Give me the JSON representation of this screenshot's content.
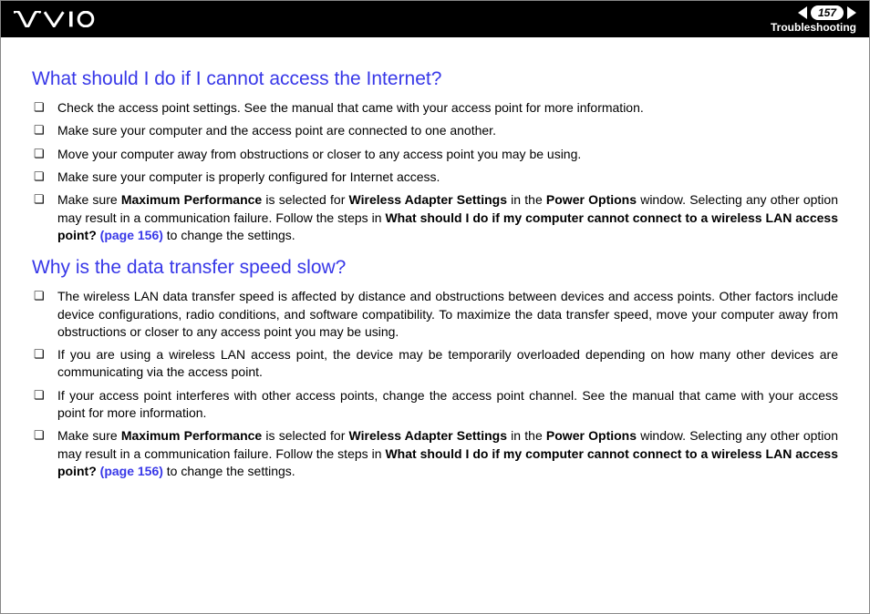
{
  "header": {
    "page_number": "157",
    "section": "Troubleshooting"
  },
  "sections": [
    {
      "heading": "What should I do if I cannot access the Internet?",
      "items": [
        {
          "type": "plain",
          "text": "Check the access point settings. See the manual that came with your access point for more information."
        },
        {
          "type": "plain",
          "text": "Make sure your computer and the access point are connected to one another."
        },
        {
          "type": "plain",
          "text": "Move your computer away from obstructions or closer to any access point you may be using."
        },
        {
          "type": "plain",
          "text": "Make sure your computer is properly configured for Internet access."
        },
        {
          "type": "rich",
          "pre": "Make sure ",
          "b1": "Maximum Performance",
          "mid1": " is selected for ",
          "b2": "Wireless Adapter Settings",
          "mid2": " in the ",
          "b3": "Power Options",
          "mid3": " window. Selecting any other option may result in a communication failure. Follow the steps in ",
          "b4": "What should I do if my computer cannot connect to a wireless LAN access point?",
          "link": " (page 156)",
          "post": " to change the settings."
        }
      ]
    },
    {
      "heading": "Why is the data transfer speed slow?",
      "items": [
        {
          "type": "plain",
          "text": "The wireless LAN data transfer speed is affected by distance and obstructions between devices and access points. Other factors include device configurations, radio conditions, and software compatibility. To maximize the data transfer speed, move your computer away from obstructions or closer to any access point you may be using."
        },
        {
          "type": "plain",
          "text": "If you are using a wireless LAN access point, the device may be temporarily overloaded depending on how many other devices are communicating via the access point."
        },
        {
          "type": "plain",
          "text": "If your access point interferes with other access points, change the access point channel. See the manual that came with your access point for more information."
        },
        {
          "type": "rich",
          "pre": "Make sure ",
          "b1": "Maximum Performance",
          "mid1": " is selected for ",
          "b2": "Wireless Adapter Settings",
          "mid2": " in the ",
          "b3": "Power Options",
          "mid3": " window. Selecting any other option may result in a communication failure. Follow the steps in ",
          "b4": "What should I do if my computer cannot connect to a wireless LAN access point?",
          "link": " (page 156)",
          "post": " to change the settings."
        }
      ]
    }
  ]
}
